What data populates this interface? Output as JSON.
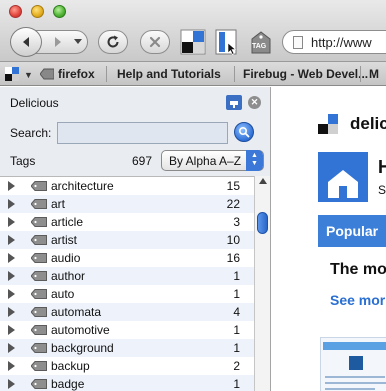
{
  "toolbar": {
    "url_text": "http://www",
    "tag_label": "TAG"
  },
  "bookmarks_bar": {
    "items": [
      "firefox",
      "Help and Tutorials",
      "Firebug - Web Devel...",
      "M"
    ]
  },
  "sidebar": {
    "title": "Delicious",
    "search_label": "Search:",
    "search_value": "",
    "tags_label": "Tags",
    "tags_count": "697",
    "sort_value": "By Alpha A–Z",
    "tags": [
      {
        "name": "architecture",
        "count": "15"
      },
      {
        "name": "art",
        "count": "22"
      },
      {
        "name": "article",
        "count": "3"
      },
      {
        "name": "artist",
        "count": "10"
      },
      {
        "name": "audio",
        "count": "16"
      },
      {
        "name": "author",
        "count": "1"
      },
      {
        "name": "auto",
        "count": "1"
      },
      {
        "name": "automata",
        "count": "4"
      },
      {
        "name": "automotive",
        "count": "1"
      },
      {
        "name": "background",
        "count": "1"
      },
      {
        "name": "backup",
        "count": "2"
      },
      {
        "name": "badge",
        "count": "1"
      }
    ]
  },
  "content": {
    "brand": "delici",
    "hero_title": "H",
    "hero_sub": "S",
    "popular_label": "Popular",
    "heading": "The mo",
    "see_more": "See mor"
  },
  "colors": {
    "accent_blue": "#3274d6",
    "link_blue": "#2a6fd2",
    "sidebar_bg": "#e9ecf1",
    "row_alt": "#eef3fb"
  }
}
